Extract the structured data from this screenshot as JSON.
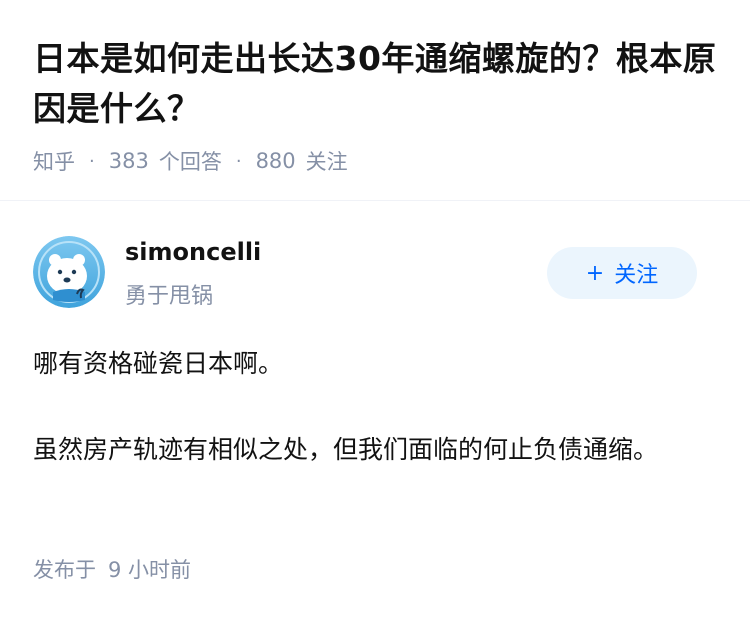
{
  "question": {
    "title": "日本是如何走出长达30年通缩螺旋的？根本原因是什么？",
    "source": "知乎",
    "answers_count": "383",
    "answers_label": "个回答",
    "followers_count": "880",
    "followers_label": "关注"
  },
  "answer": {
    "author": {
      "name": "simoncelli",
      "bio": "勇于甩锅",
      "avatar_icon": "polar-bear-avatar"
    },
    "follow_label": "关注",
    "paragraphs": [
      "哪有资格碰瓷日本啊。",
      "虽然房产轨迹有相似之处，但我们面临的何止负债通缩。"
    ],
    "time_prefix": "发布于",
    "time_value": "9 小时前"
  },
  "colors": {
    "accent": "#0066ff",
    "accent_bg": "#ebf5fd",
    "meta_gray": "#8590a6",
    "text": "#121212"
  }
}
